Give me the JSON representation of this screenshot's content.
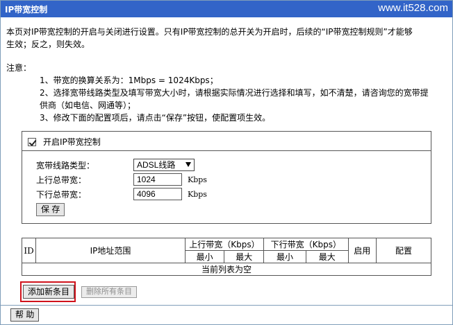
{
  "header": {
    "title": "IP带宽控制",
    "watermark": "www.it528.com"
  },
  "intro": {
    "line1": "本页对IP带宽控制的开启与关闭进行设置。只有IP带宽控制的总开关为开启时，后续的“IP带宽控制规则”才能够",
    "line2": "生效；反之，则失效。"
  },
  "notes": {
    "title": "注意：",
    "item1": "1、带宽的换算关系为：1Mbps = 1024Kbps；",
    "item2a": "2、选择宽带线路类型及填写带宽大小时，请根据实际情况进行选择和填写，如不清楚，请咨询您的宽带提",
    "item2b": "供商（如电信、网通等）；",
    "item3": "3、修改下面的配置项后，请点击“保存”按钮，使配置项生效。"
  },
  "settings": {
    "enable_label": "开启IP带宽控制",
    "enabled": true,
    "line_type_label": "宽带线路类型：",
    "line_type_value": "ADSL线路",
    "up_label": "上行总带宽：",
    "up_value": "1024",
    "up_unit": "Kbps",
    "down_label": "下行总带宽：",
    "down_value": "4096",
    "down_unit": "Kbps",
    "save_label": "保 存"
  },
  "table": {
    "col_id": "ID",
    "col_ip": "IP地址范围",
    "col_up": "上行带宽（Kbps）",
    "col_down": "下行带宽（Kbps）",
    "col_enabled": "启用",
    "col_config": "配置",
    "sub_min": "最小",
    "sub_max": "最大",
    "empty_text": "当前列表为空"
  },
  "actions": {
    "add_label": "添加新条目",
    "delete_all_label": "删除所有条目",
    "help_label": "帮 助"
  },
  "colors": {
    "title_bar": "#3264c8",
    "highlight_border": "#d0121b"
  }
}
